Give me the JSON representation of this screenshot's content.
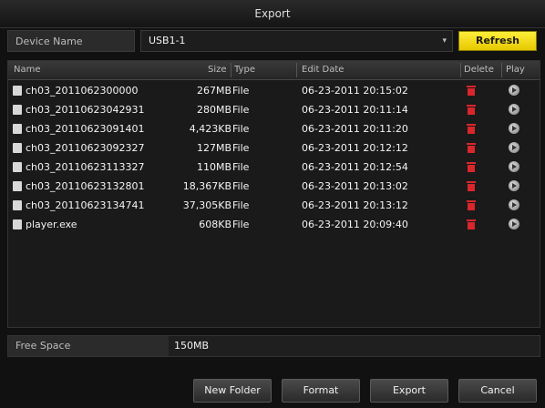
{
  "window": {
    "title": "Export"
  },
  "device": {
    "label": "Device Name",
    "value": "USB1-1",
    "refresh_label": "Refresh"
  },
  "table": {
    "columns": {
      "name": "Name",
      "size": "Size",
      "type": "Type",
      "edit_date": "Edit Date",
      "delete": "Delete",
      "play": "Play"
    },
    "rows": [
      {
        "name": "ch03_2011062300000",
        "size": "267MB",
        "type": "File",
        "date": "06-23-2011 20:15:02"
      },
      {
        "name": "ch03_20110623042931",
        "size": "280MB",
        "type": "File",
        "date": "06-23-2011 20:11:14"
      },
      {
        "name": "ch03_20110623091401",
        "size": "4,423KB",
        "type": "File",
        "date": "06-23-2011 20:11:20"
      },
      {
        "name": "ch03_20110623092327",
        "size": "127MB",
        "type": "File",
        "date": "06-23-2011 20:12:12"
      },
      {
        "name": "ch03_20110623113327",
        "size": "110MB",
        "type": "File",
        "date": "06-23-2011 20:12:54"
      },
      {
        "name": "ch03_20110623132801",
        "size": "18,367KB",
        "type": "File",
        "date": "06-23-2011 20:13:02"
      },
      {
        "name": "ch03_20110623134741",
        "size": "37,305KB",
        "type": "File",
        "date": "06-23-2011 20:13:12"
      },
      {
        "name": "player.exe",
        "size": "608KB",
        "type": "File",
        "date": "06-23-2011 20:09:40"
      }
    ]
  },
  "free_space": {
    "label": "Free Space",
    "value": "150MB"
  },
  "footer": {
    "new_folder": "New Folder",
    "format": "Format",
    "export": "Export",
    "cancel": "Cancel"
  },
  "colors": {
    "refresh_button": "#f2de10",
    "delete_icon": "#d9262b",
    "background": "#111111"
  },
  "icons": {
    "file": "file-icon",
    "delete": "trash-icon",
    "play": "play-icon",
    "dropdown": "chevron-down-icon"
  }
}
